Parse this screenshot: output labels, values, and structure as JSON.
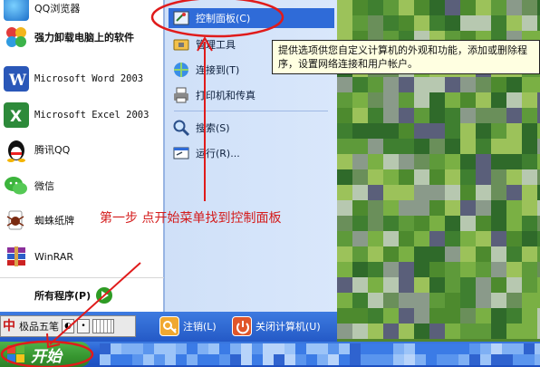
{
  "start_menu": {
    "pinned_programs": [
      {
        "label": "QQ浏览器",
        "icon": "qq-browser-icon",
        "mono": false
      },
      {
        "label": "强力卸载电脑上的软件",
        "icon": "uninstaller-icon",
        "mono": false,
        "bold": true
      },
      {
        "label": "Microsoft Word 2003",
        "icon": "word-icon",
        "mono": true
      },
      {
        "label": "Microsoft Excel 2003",
        "icon": "excel-icon",
        "mono": true
      },
      {
        "label": "腾讯QQ",
        "icon": "qq-penguin-icon",
        "mono": false
      },
      {
        "label": "微信",
        "icon": "wechat-icon",
        "mono": false
      },
      {
        "label": "蜘蛛纸牌",
        "icon": "spider-solitaire-icon",
        "mono": false
      },
      {
        "label": "WinRAR",
        "icon": "winrar-icon",
        "mono": false
      }
    ],
    "all_programs_label": "所有程序(P)",
    "right_items": [
      {
        "label": "控制面板(C)",
        "icon": "control-panel-icon",
        "selected": true
      },
      {
        "label": "管理工具",
        "icon": "admin-tools-icon",
        "selected": false
      },
      {
        "label": "连接到(T)",
        "icon": "connect-to-icon",
        "selected": false
      },
      {
        "label": "打印机和传真",
        "icon": "printer-icon",
        "selected": false
      },
      {
        "label": "搜索(S)",
        "icon": "search-icon",
        "selected": false
      },
      {
        "label": "运行(R)...",
        "icon": "run-icon",
        "selected": false
      }
    ],
    "logoff_label": "注销(L)",
    "shutdown_label": "关闭计算机(U)"
  },
  "ime": {
    "logo": "中",
    "name": "极品五笔"
  },
  "tooltip": {
    "text": "提供选项供您自定义计算机的外观和功能，添加或删除程序，设置网络连接和用户帐户。"
  },
  "annotation": {
    "text": "第一步 点开始菜单找到控制面板",
    "color": "#d41c1c"
  },
  "taskbar": {
    "start_label": "开始"
  },
  "colors": {
    "accent_blue": "#2f6bd8",
    "start_green": "#36952f",
    "annotation_red": "#d41c1c"
  }
}
